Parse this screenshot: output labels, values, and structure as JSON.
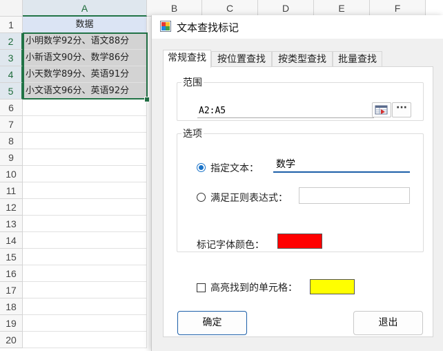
{
  "sheet": {
    "columns": [
      "A",
      "B",
      "C",
      "D",
      "E",
      "F"
    ],
    "rows": [
      "1",
      "2",
      "3",
      "4",
      "5",
      "6",
      "7",
      "8",
      "9",
      "10",
      "11",
      "12",
      "13",
      "14",
      "15",
      "16",
      "17",
      "18",
      "19",
      "20"
    ],
    "cells": [
      "数据",
      "小明数学92分、语文88分",
      "小新语文90分、数学86分",
      "小天数学89分、英语91分",
      "小文语文96分、英语92分"
    ]
  },
  "dialog": {
    "title": "文本查找标记",
    "tabs": [
      "常规查找",
      "按位置查找",
      "按类型查找",
      "批量查找"
    ],
    "range_group": {
      "legend": "范围",
      "value": "A2:A5",
      "more_label": "···"
    },
    "options_group": {
      "legend": "选项",
      "specify_text_label": "指定文本：",
      "specify_text_value": "数学",
      "regex_label": "满足正则表达式：",
      "regex_value": "",
      "mark_color_label": "标记字体颜色：",
      "mark_color": "#ff0000"
    },
    "highlight_label": "高亮找到的单元格：",
    "highlight_color": "#ffff00",
    "ok_label": "确定",
    "exit_label": "退出"
  }
}
